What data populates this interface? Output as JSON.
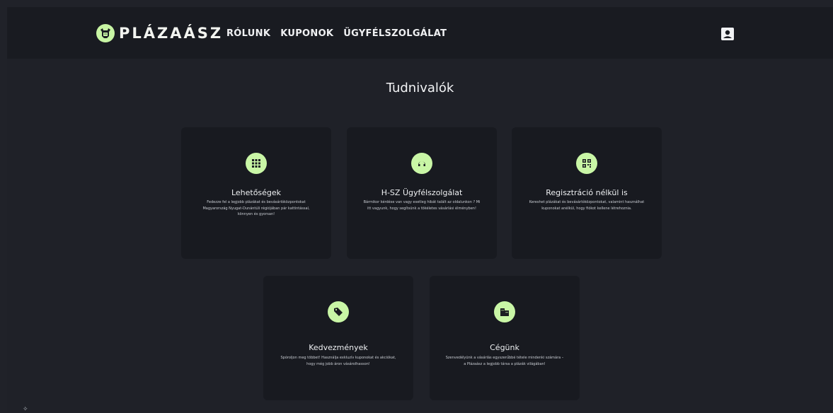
{
  "header": {
    "brand": "PLÁZAÁSZ",
    "nav": [
      "RÓLUNK",
      "KUPONOK",
      "ÜGYFÉLSZOLGÁLAT"
    ],
    "logo_icon": "moose-logo-icon",
    "account_icon": "account-box-icon"
  },
  "main": {
    "heading": "Tudnivalók",
    "cards": [
      {
        "icon": "grid-icon",
        "title": "Lehetőségek",
        "text": "Fedezze fel a legjobb plázákat és bevásárlóközpontokat Magyarország Nyugat-Dunántúli régiójában pár kattintással, könnyen és gyorsan!"
      },
      {
        "icon": "support-icon",
        "title": "H-SZ Ügyfélszolgálat",
        "text": "Bármikor kérdése van vagy esetleg hibát talált az oldalunkon ? Mi itt vagyunk, hogy segítsünk a tökéletes vásárlási élményben!"
      },
      {
        "icon": "qr-icon",
        "title": "Regisztráció nélkül is",
        "text": "Kereshet plázákat és bevásárlóközpontokat, valamint használhat kuponokat anélkül, hogy fiókot kellene létrehoznia."
      },
      {
        "icon": "tag-icon",
        "title": "Kedvezmények",
        "text": "Spóroljon meg többet! Használja exkluzív kuponokat és akciókat, hogy még jobb áron vásárolhasson!"
      },
      {
        "icon": "business-icon",
        "title": "Cégünk",
        "text": "Szenvedélyünk a vásárlás egyszerűbbé tétele mindenki számára – a Plázaász a legjobb társa a plázák világában!"
      }
    ]
  },
  "colors": {
    "background": "#1f2128",
    "navbar": "#191b21",
    "card": "#181a20",
    "accent": "#c9f6a6"
  }
}
